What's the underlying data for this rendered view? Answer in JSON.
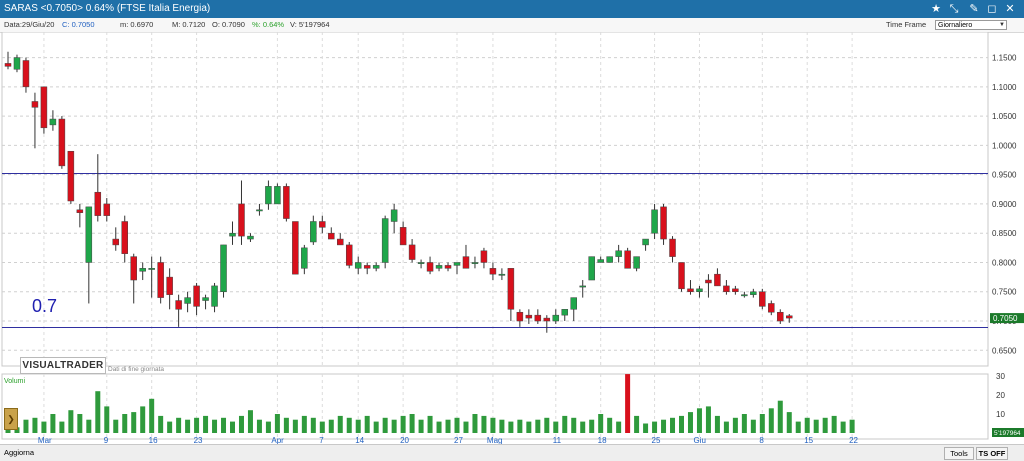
{
  "window": {
    "title": "SARAS <0.7050> 0.64%  (FTSE Italia Energia)",
    "icons": [
      "star-icon",
      "tools-icon",
      "link-icon",
      "close-icon"
    ]
  },
  "infobar": {
    "date": "Data:29/Giu/20",
    "close": "C: 0.7050",
    "min": "m: 0.6970",
    "max": "M: 0.7120",
    "open": "O: 0.7090",
    "var": "%: 0.64%",
    "volume": "V: 5'197964",
    "time_frame_label": "Time Frame",
    "time_frame_value": "Giornaliero"
  },
  "branding": {
    "logo": "VISUALTRADER",
    "subtitle": "Dati di fine giornata"
  },
  "annotation": {
    "level_label": "0.7"
  },
  "volume_panel": {
    "title": "Volumi",
    "ticks": [
      "30",
      "20",
      "10"
    ],
    "last_value_label": "5'197964"
  },
  "bottom_bar": {
    "left_label": "Aggiorna",
    "tools_label": "Tools",
    "toggle_label": "TS OFF"
  },
  "colors": {
    "up": "#1fa64a",
    "down": "#d8101c",
    "level_line": "#3030a0",
    "volume_bar": "#2f9a3c",
    "volume_spike": "#d8101c",
    "last_price_tag": "#1b7a2a"
  },
  "chart_data": {
    "type": "candlestick",
    "price_axis": {
      "min": 0.63,
      "max": 1.18,
      "ticks": [
        1.15,
        1.1,
        1.05,
        1.0,
        0.95,
        0.9,
        0.85,
        0.8,
        0.75,
        0.7,
        0.65
      ]
    },
    "price_tick_labels": [
      "1.1500",
      "1.1000",
      "1.0500",
      "1.0000",
      "0.9500",
      "0.9000",
      "0.8500",
      "0.8000",
      "0.7500",
      "0.7000",
      "0.6500"
    ],
    "last_price_label": "0.7050",
    "horizontal_lines": [
      0.952,
      0.689
    ],
    "x_tick_labels": [
      "Mar",
      "9",
      "16",
      "23",
      "Apr",
      "7",
      "14",
      "20",
      "27",
      "Mag",
      "11",
      "18",
      "25",
      "Giu",
      "8",
      "15",
      "22"
    ],
    "x_tick_index": [
      4,
      11,
      16,
      21,
      30,
      35,
      39,
      44,
      50,
      54,
      61,
      66,
      72,
      77,
      84,
      89,
      94
    ],
    "month_tick_labels": [
      "Mar",
      "Apr",
      "Mag",
      "Giu"
    ],
    "candles": [
      {
        "o": 1.14,
        "h": 1.16,
        "l": 1.13,
        "c": 1.135
      },
      {
        "o": 1.13,
        "h": 1.155,
        "l": 1.125,
        "c": 1.15
      },
      {
        "o": 1.145,
        "h": 1.15,
        "l": 1.09,
        "c": 1.1
      },
      {
        "o": 1.075,
        "h": 1.09,
        "l": 0.995,
        "c": 1.065
      },
      {
        "o": 1.1,
        "h": 1.1,
        "l": 1.02,
        "c": 1.03
      },
      {
        "o": 1.035,
        "h": 1.06,
        "l": 1.025,
        "c": 1.045
      },
      {
        "o": 1.045,
        "h": 1.05,
        "l": 0.96,
        "c": 0.965
      },
      {
        "o": 0.99,
        "h": 0.99,
        "l": 0.9,
        "c": 0.905
      },
      {
        "o": 0.89,
        "h": 0.9,
        "l": 0.86,
        "c": 0.885
      },
      {
        "o": 0.8,
        "h": 0.895,
        "l": 0.73,
        "c": 0.895
      },
      {
        "o": 0.92,
        "h": 0.985,
        "l": 0.87,
        "c": 0.88
      },
      {
        "o": 0.9,
        "h": 0.91,
        "l": 0.87,
        "c": 0.88
      },
      {
        "o": 0.84,
        "h": 0.86,
        "l": 0.82,
        "c": 0.83
      },
      {
        "o": 0.87,
        "h": 0.88,
        "l": 0.8,
        "c": 0.815
      },
      {
        "o": 0.81,
        "h": 0.815,
        "l": 0.73,
        "c": 0.77
      },
      {
        "o": 0.785,
        "h": 0.8,
        "l": 0.77,
        "c": 0.79
      },
      {
        "o": 0.79,
        "h": 0.81,
        "l": 0.74,
        "c": 0.79
      },
      {
        "o": 0.8,
        "h": 0.81,
        "l": 0.73,
        "c": 0.74
      },
      {
        "o": 0.775,
        "h": 0.79,
        "l": 0.72,
        "c": 0.745
      },
      {
        "o": 0.735,
        "h": 0.745,
        "l": 0.69,
        "c": 0.72
      },
      {
        "o": 0.73,
        "h": 0.75,
        "l": 0.715,
        "c": 0.74
      },
      {
        "o": 0.76,
        "h": 0.765,
        "l": 0.71,
        "c": 0.725
      },
      {
        "o": 0.735,
        "h": 0.745,
        "l": 0.72,
        "c": 0.74
      },
      {
        "o": 0.725,
        "h": 0.765,
        "l": 0.715,
        "c": 0.76
      },
      {
        "o": 0.75,
        "h": 0.83,
        "l": 0.74,
        "c": 0.83
      },
      {
        "o": 0.845,
        "h": 0.87,
        "l": 0.83,
        "c": 0.85
      },
      {
        "o": 0.9,
        "h": 0.94,
        "l": 0.83,
        "c": 0.845
      },
      {
        "o": 0.84,
        "h": 0.85,
        "l": 0.835,
        "c": 0.845
      },
      {
        "o": 0.89,
        "h": 0.9,
        "l": 0.88,
        "c": 0.89
      },
      {
        "o": 0.9,
        "h": 0.94,
        "l": 0.89,
        "c": 0.93
      },
      {
        "o": 0.9,
        "h": 0.935,
        "l": 0.9,
        "c": 0.93
      },
      {
        "o": 0.93,
        "h": 0.935,
        "l": 0.87,
        "c": 0.875
      },
      {
        "o": 0.87,
        "h": 0.87,
        "l": 0.78,
        "c": 0.78
      },
      {
        "o": 0.79,
        "h": 0.83,
        "l": 0.78,
        "c": 0.825
      },
      {
        "o": 0.835,
        "h": 0.88,
        "l": 0.83,
        "c": 0.87
      },
      {
        "o": 0.87,
        "h": 0.88,
        "l": 0.85,
        "c": 0.86
      },
      {
        "o": 0.85,
        "h": 0.86,
        "l": 0.84,
        "c": 0.84
      },
      {
        "o": 0.84,
        "h": 0.85,
        "l": 0.83,
        "c": 0.83
      },
      {
        "o": 0.83,
        "h": 0.835,
        "l": 0.79,
        "c": 0.795
      },
      {
        "o": 0.79,
        "h": 0.81,
        "l": 0.78,
        "c": 0.8
      },
      {
        "o": 0.795,
        "h": 0.8,
        "l": 0.78,
        "c": 0.79
      },
      {
        "o": 0.79,
        "h": 0.8,
        "l": 0.785,
        "c": 0.795
      },
      {
        "o": 0.8,
        "h": 0.88,
        "l": 0.79,
        "c": 0.875
      },
      {
        "o": 0.87,
        "h": 0.9,
        "l": 0.85,
        "c": 0.89
      },
      {
        "o": 0.86,
        "h": 0.87,
        "l": 0.83,
        "c": 0.83
      },
      {
        "o": 0.83,
        "h": 0.84,
        "l": 0.8,
        "c": 0.805
      },
      {
        "o": 0.8,
        "h": 0.805,
        "l": 0.79,
        "c": 0.8
      },
      {
        "o": 0.8,
        "h": 0.81,
        "l": 0.78,
        "c": 0.785
      },
      {
        "o": 0.79,
        "h": 0.8,
        "l": 0.785,
        "c": 0.795
      },
      {
        "o": 0.795,
        "h": 0.8,
        "l": 0.785,
        "c": 0.79
      },
      {
        "o": 0.795,
        "h": 0.8,
        "l": 0.78,
        "c": 0.8
      },
      {
        "o": 0.81,
        "h": 0.83,
        "l": 0.79,
        "c": 0.79
      },
      {
        "o": 0.8,
        "h": 0.81,
        "l": 0.79,
        "c": 0.8
      },
      {
        "o": 0.82,
        "h": 0.825,
        "l": 0.79,
        "c": 0.8
      },
      {
        "o": 0.79,
        "h": 0.8,
        "l": 0.77,
        "c": 0.78
      },
      {
        "o": 0.78,
        "h": 0.79,
        "l": 0.77,
        "c": 0.78
      },
      {
        "o": 0.79,
        "h": 0.79,
        "l": 0.7,
        "c": 0.72
      },
      {
        "o": 0.715,
        "h": 0.72,
        "l": 0.69,
        "c": 0.7
      },
      {
        "o": 0.71,
        "h": 0.72,
        "l": 0.695,
        "c": 0.705
      },
      {
        "o": 0.71,
        "h": 0.72,
        "l": 0.695,
        "c": 0.7
      },
      {
        "o": 0.705,
        "h": 0.71,
        "l": 0.68,
        "c": 0.7
      },
      {
        "o": 0.7,
        "h": 0.72,
        "l": 0.695,
        "c": 0.71
      },
      {
        "o": 0.71,
        "h": 0.72,
        "l": 0.7,
        "c": 0.72
      },
      {
        "o": 0.72,
        "h": 0.74,
        "l": 0.7,
        "c": 0.74
      },
      {
        "o": 0.76,
        "h": 0.77,
        "l": 0.74,
        "c": 0.76
      },
      {
        "o": 0.77,
        "h": 0.81,
        "l": 0.77,
        "c": 0.81
      },
      {
        "o": 0.8,
        "h": 0.81,
        "l": 0.8,
        "c": 0.805
      },
      {
        "o": 0.8,
        "h": 0.81,
        "l": 0.8,
        "c": 0.81
      },
      {
        "o": 0.81,
        "h": 0.83,
        "l": 0.8,
        "c": 0.82
      },
      {
        "o": 0.82,
        "h": 0.825,
        "l": 0.79,
        "c": 0.79
      },
      {
        "o": 0.79,
        "h": 0.81,
        "l": 0.785,
        "c": 0.81
      },
      {
        "o": 0.83,
        "h": 0.84,
        "l": 0.82,
        "c": 0.84
      },
      {
        "o": 0.85,
        "h": 0.9,
        "l": 0.84,
        "c": 0.89
      },
      {
        "o": 0.895,
        "h": 0.9,
        "l": 0.83,
        "c": 0.84
      },
      {
        "o": 0.84,
        "h": 0.845,
        "l": 0.8,
        "c": 0.81
      },
      {
        "o": 0.8,
        "h": 0.8,
        "l": 0.75,
        "c": 0.755
      },
      {
        "o": 0.755,
        "h": 0.77,
        "l": 0.745,
        "c": 0.75
      },
      {
        "o": 0.75,
        "h": 0.76,
        "l": 0.74,
        "c": 0.755
      },
      {
        "o": 0.77,
        "h": 0.78,
        "l": 0.74,
        "c": 0.765
      },
      {
        "o": 0.78,
        "h": 0.79,
        "l": 0.76,
        "c": 0.76
      },
      {
        "o": 0.76,
        "h": 0.77,
        "l": 0.745,
        "c": 0.75
      },
      {
        "o": 0.755,
        "h": 0.76,
        "l": 0.745,
        "c": 0.75
      },
      {
        "o": 0.745,
        "h": 0.75,
        "l": 0.74,
        "c": 0.745
      },
      {
        "o": 0.745,
        "h": 0.755,
        "l": 0.74,
        "c": 0.75
      },
      {
        "o": 0.75,
        "h": 0.755,
        "l": 0.72,
        "c": 0.725
      },
      {
        "o": 0.73,
        "h": 0.735,
        "l": 0.71,
        "c": 0.715
      },
      {
        "o": 0.715,
        "h": 0.72,
        "l": 0.695,
        "c": 0.7
      },
      {
        "o": 0.709,
        "h": 0.712,
        "l": 0.697,
        "c": 0.705
      }
    ],
    "volume": {
      "scale_max": 30,
      "values": [
        6,
        3,
        7,
        8,
        6,
        10,
        6,
        12,
        10,
        7,
        22,
        14,
        7,
        10,
        11,
        14,
        18,
        9,
        6,
        8,
        7,
        8,
        9,
        7,
        8,
        6,
        9,
        12,
        7,
        6,
        10,
        8,
        7,
        9,
        8,
        6,
        7,
        9,
        8,
        7,
        9,
        6,
        8,
        7,
        9,
        10,
        7,
        9,
        6,
        7,
        8,
        6,
        10,
        9,
        8,
        7,
        6,
        7,
        6,
        7,
        8,
        6,
        9,
        8,
        6,
        7,
        10,
        8,
        6,
        31,
        9,
        5,
        6,
        7,
        8,
        9,
        11,
        13,
        14,
        9,
        6,
        8,
        10,
        7,
        10,
        13,
        17,
        11,
        6,
        8,
        7,
        8,
        9,
        6,
        7
      ],
      "spike_index": 69
    }
  }
}
